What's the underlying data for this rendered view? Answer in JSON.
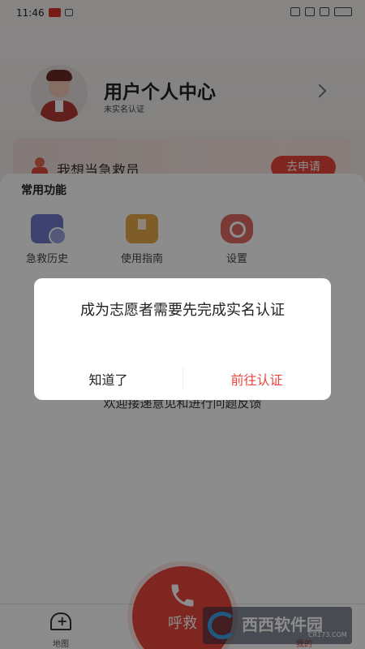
{
  "status_bar": {
    "time": "11:46"
  },
  "header": {
    "title": "用户个人中心",
    "subtitle": "未实名认证"
  },
  "volunteer_card": {
    "label": "我想当急救员",
    "apply_label": "去申请"
  },
  "functions": {
    "title": "常用功能",
    "items": [
      {
        "label": "急救历史",
        "icon": "history-icon"
      },
      {
        "label": "使用指南",
        "icon": "guide-icon"
      },
      {
        "label": "设置",
        "icon": "settings-icon"
      }
    ]
  },
  "feedback": {
    "text": "欢迎接递意见和进行问题反馈"
  },
  "tabbar": {
    "map_label": "地图",
    "call_label": "呼救",
    "mine_label": "我的"
  },
  "watermark": {
    "name": "西西软件园",
    "site": "CR173.COM"
  },
  "dialog": {
    "message": "成为志愿者需要先完成实名认证",
    "ok_label": "知道了",
    "go_label": "前往认证"
  },
  "colors": {
    "accent": "#e8453c",
    "overlay": "rgba(0,0,0,0.45)"
  }
}
